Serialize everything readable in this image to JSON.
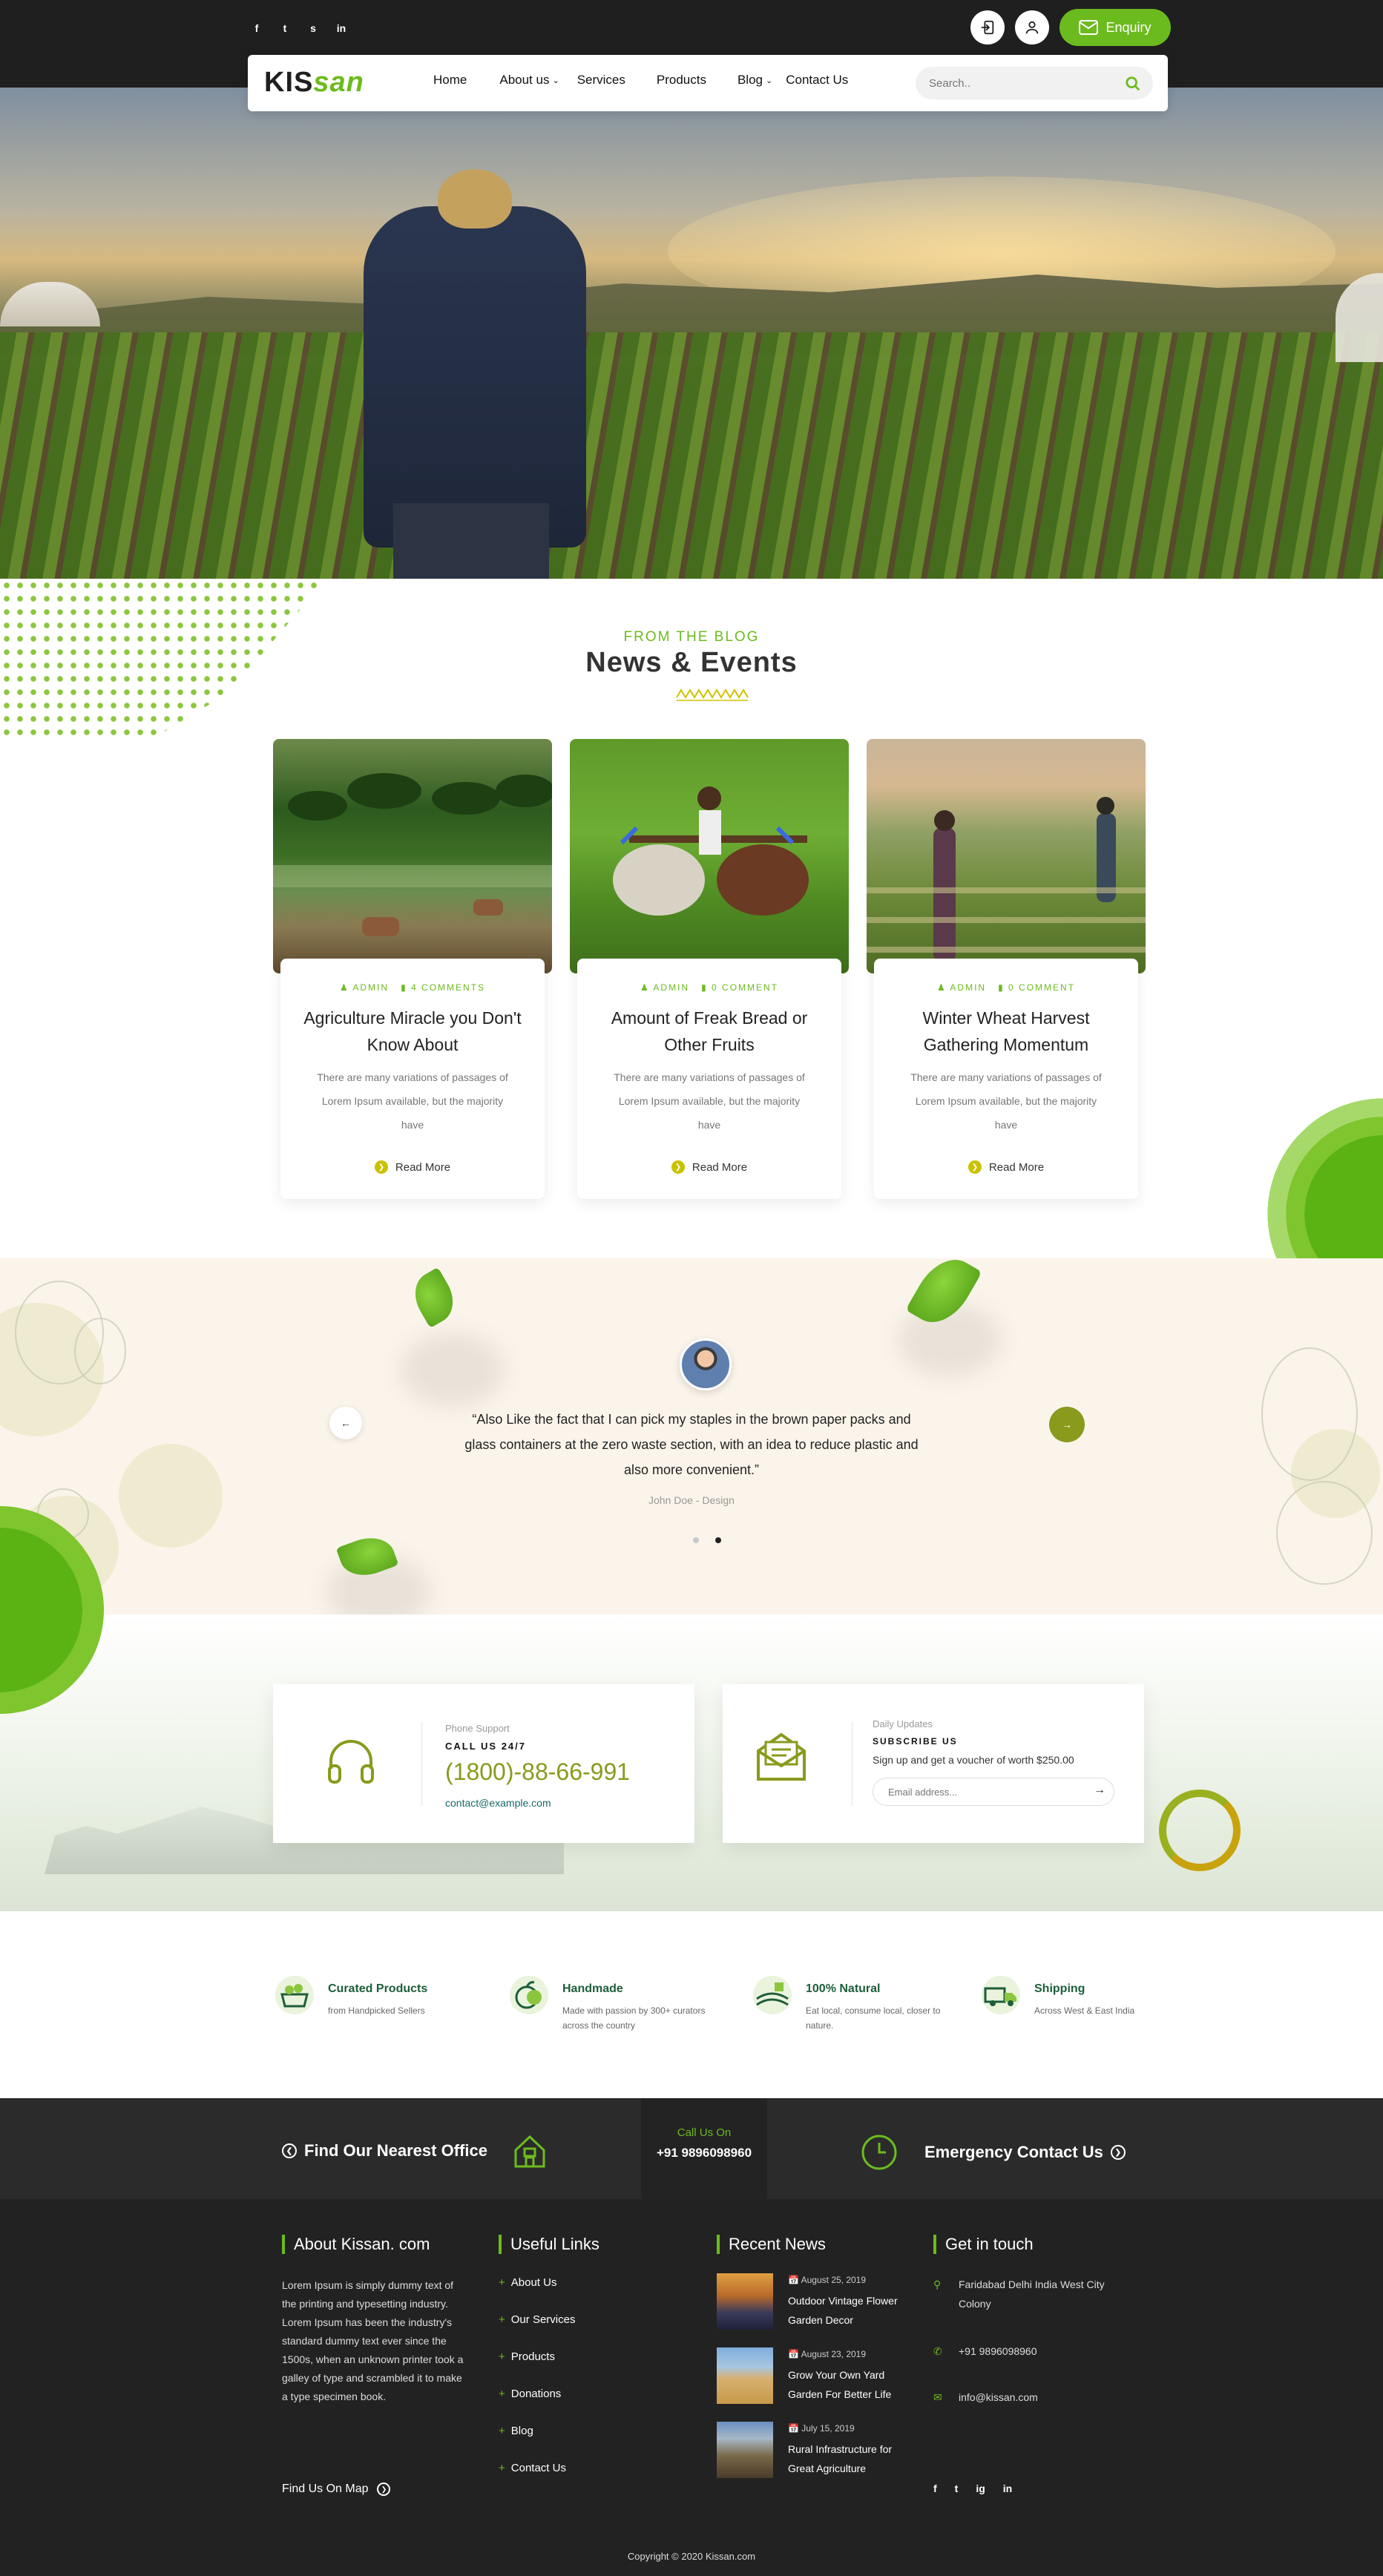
{
  "topbar": {
    "social": [
      "f",
      "t",
      "s",
      "in"
    ],
    "enquiry_label": "Enquiry"
  },
  "nav": {
    "logo_kis": "KIS",
    "logo_san": "san",
    "items": [
      "Home",
      "About us",
      "Services",
      "Products",
      "Blog",
      "Contact Us"
    ],
    "search_placeholder": "Search.."
  },
  "blog": {
    "eyebrow": "FROM THE BLOG",
    "title": "News & Events",
    "posts": [
      {
        "author": "ADMIN",
        "comments": "4 COMMENTS",
        "title": "Agriculture Miracle you Don't Know About",
        "text": "There are many variations of passages of Lorem Ipsum available, but the majority have",
        "more": "Read More"
      },
      {
        "author": "ADMIN",
        "comments": "0 COMMENT",
        "title": "Amount of Freak Bread or Other Fruits",
        "text": "There are many variations of passages of Lorem Ipsum available, but the majority have",
        "more": "Read More"
      },
      {
        "author": "ADMIN",
        "comments": "0 COMMENT",
        "title": "Winter Wheat Harvest Gathering Momentum",
        "text": "There are many variations of passages of Lorem Ipsum available, but the majority have",
        "more": "Read More"
      }
    ]
  },
  "testimonial": {
    "quote": "“Also Like the fact that I can pick my staples in the brown paper packs and glass containers at the zero waste section, with an idea to reduce plastic and also more convenient.”",
    "author": "John Doe - Design"
  },
  "support": {
    "label": "Phone Support",
    "call_label": "CALL US 24/7",
    "phone": "(1800)-88-66-991",
    "email": "contact@example.com"
  },
  "subscribe": {
    "label": "Daily Updates",
    "title": "SUBSCRIBE US",
    "text": "Sign up and get a voucher of worth $250.00",
    "placeholder": "Email address..."
  },
  "features": [
    {
      "title": "Curated Products",
      "desc": "from Handpicked Sellers",
      "icon": "basket-icon"
    },
    {
      "title": "Handmade",
      "desc": "Made with passion by 300+ curators across the country",
      "icon": "fruit-icon"
    },
    {
      "title": "100% Natural",
      "desc": "Eat local, consume local, closer to nature.",
      "icon": "field-icon"
    },
    {
      "title": "Shipping",
      "desc": "Across West & East India",
      "icon": "truck-icon"
    }
  ],
  "office": {
    "find_office": "Find Our Nearest Office",
    "call_label": "Call Us On",
    "call_number": "+91 9896098960",
    "emergency": "Emergency Contact Us"
  },
  "footer": {
    "about_title": "About Kissan. com",
    "about_text": "Lorem Ipsum is simply dummy text of the printing and typesetting industry. Lorem Ipsum has been the industry's standard dummy text ever since the 1500s, when an unknown printer took a galley of type and scrambled it to make a type specimen book.",
    "map_link": "Find Us On Map",
    "links_title": "Useful Links",
    "links": [
      "About Us",
      "Our Services",
      "Products",
      "Donations",
      "Blog",
      "Contact Us"
    ],
    "news_title": "Recent News",
    "news": [
      {
        "date": "August 25, 2019",
        "title": "Outdoor Vintage Flower Garden Decor"
      },
      {
        "date": "August 23, 2019",
        "title": "Grow Your Own Yard Garden For Better Life"
      },
      {
        "date": "July 15, 2019",
        "title": "Rural Infrastructure for Great Agriculture"
      }
    ],
    "touch_title": "Get in touch",
    "address": "Faridabad Delhi India West City Colony",
    "phone": "+91 9896098960",
    "email": "info@kissan.com",
    "social": [
      "f",
      "t",
      "ig",
      "in"
    ],
    "copyright": "Copyright © 2020 Kissan.com"
  },
  "colors": {
    "brand_green": "#6cbb1e",
    "olive": "#8a9a1c",
    "dark": "#222222"
  }
}
